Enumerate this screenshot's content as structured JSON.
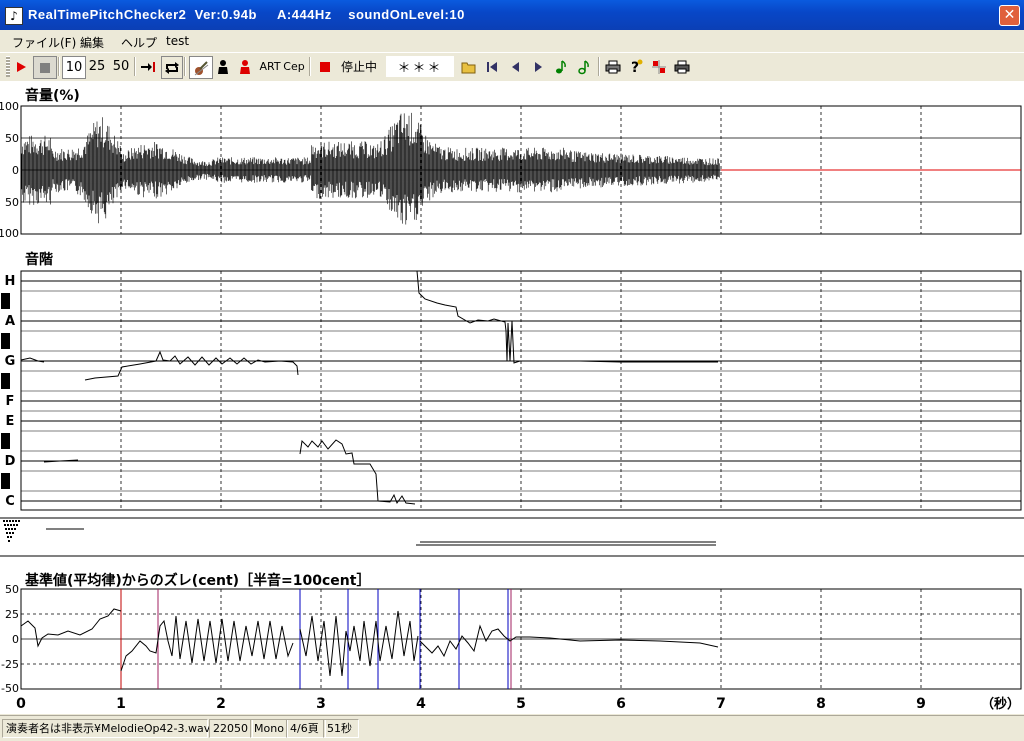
{
  "window": {
    "title": "RealTimePitchChecker2  Ver:0.94b     A:444Hz    soundOnLevel:10",
    "close_glyph": "✕",
    "app_icon": "tuning-fork-icon"
  },
  "menu": [
    "ファイル(F)",
    "編集",
    "ヘルプ",
    "test"
  ],
  "toolbar": {
    "zoom_options": [
      "10",
      "25",
      "50"
    ],
    "art_label": "ART",
    "cep_label": "Cep",
    "status_label": "停止中",
    "note_display": "＊＊＊",
    "icons": [
      "play-icon",
      "stop-icon",
      "jump-end-icon",
      "loop-icon",
      "violin-icon",
      "person-icon",
      "red-person-icon",
      "record-stop-icon",
      "open-folder-icon",
      "first-icon",
      "prev-icon",
      "next-icon",
      "note-icon",
      "note-alt-icon",
      "print-icon",
      "help-icon",
      "grid-icon",
      "printer-icon"
    ],
    "accent_colors": {
      "play": "#E00000",
      "stop": "#808080",
      "note": "#008000",
      "record": "#E00000"
    }
  },
  "panels": {
    "volume": {
      "label": "音量(%)",
      "ticks": [
        "100",
        "50",
        "0",
        "50",
        "100"
      ]
    },
    "scale": {
      "label": "音階",
      "notes": [
        "H",
        "A",
        "G",
        "F",
        "E",
        "D",
        "C"
      ]
    },
    "deviation": {
      "label": "基準値(平均律)からのズレ(cent)［半音=100cent］",
      "ticks": [
        "50",
        "25",
        "0",
        "-25",
        "-50"
      ]
    }
  },
  "time_axis": {
    "ticks": [
      "0",
      "1",
      "2",
      "3",
      "4",
      "5",
      "6",
      "7",
      "8",
      "9"
    ],
    "unit": "（秒）"
  },
  "statusbar": {
    "file": "演奏者名は非表示¥MelodieOp42-3.wav",
    "rate": "22050",
    "channels": "Mono",
    "page": "4/6頁",
    "duration": "51秒"
  }
}
